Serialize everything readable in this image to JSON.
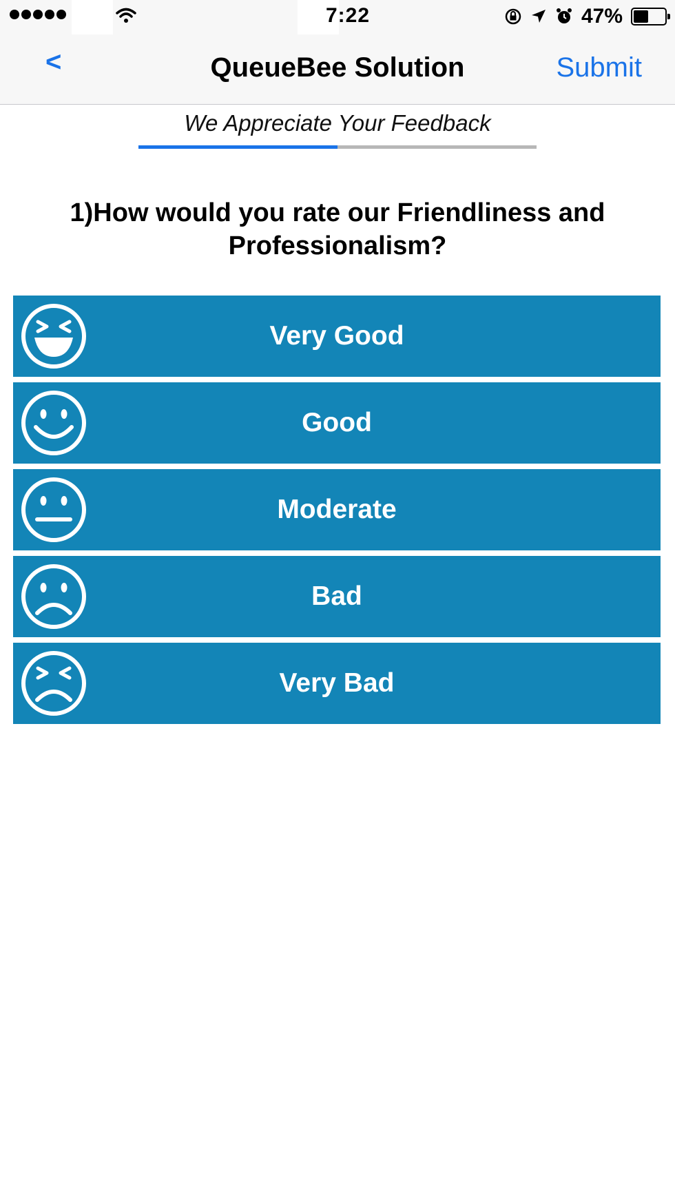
{
  "status_bar": {
    "time": "7:22",
    "battery_percent": "47%",
    "battery_level": 0.47
  },
  "nav": {
    "back_label": "<",
    "title": "QueueBee Solution",
    "submit_label": "Submit"
  },
  "survey": {
    "header": "We Appreciate Your Feedback",
    "progress": 0.5,
    "question": "1)How would you rate our Friendliness and Professionalism?",
    "options": [
      {
        "label": "Very Good",
        "icon": "laughing-face-icon"
      },
      {
        "label": "Good",
        "icon": "smiling-face-icon"
      },
      {
        "label": "Moderate",
        "icon": "neutral-face-icon"
      },
      {
        "label": "Bad",
        "icon": "sad-face-icon"
      },
      {
        "label": "Very Bad",
        "icon": "upset-face-icon"
      }
    ]
  },
  "colors": {
    "accent": "#1a73e8",
    "option_background": "#1385b7",
    "bar_background": "#f7f7f7"
  }
}
